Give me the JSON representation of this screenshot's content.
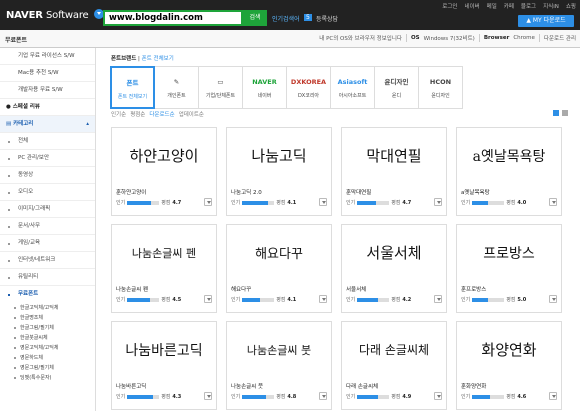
{
  "header": {
    "logo_brand": "NAVER",
    "logo_product": "Software",
    "search_value": "www.blogdalin.com",
    "search_button": "검색",
    "popular_link": "인기검색어",
    "badge": "5",
    "reg_link": "등록상담",
    "util_links": [
      "로그인",
      "네이버",
      "메일",
      "카페",
      "블로그",
      "지식iN",
      "쇼핑"
    ],
    "my_download": "MY 다운로드"
  },
  "subbar": {
    "title": "무료폰트",
    "os_notice": "내 PC의 OS와 브라우저 정보입니다",
    "os_label": "OS",
    "os_value": "Windows 7(32비트)",
    "browser_label": "Browser",
    "browser_value": "Chrome",
    "change": "다운로드 관리"
  },
  "sidebar": {
    "items": [
      {
        "label": "기업 무료 라이선스 S/W",
        "type": "item"
      },
      {
        "label": "Mac용 추천 S/W",
        "type": "item"
      },
      {
        "label": "개발자용 무료 S/W",
        "type": "item"
      },
      {
        "label": "스페셜 리뷰",
        "type": "hd"
      },
      {
        "label": "카테고리",
        "type": "hl"
      },
      {
        "label": "전체",
        "type": "item"
      },
      {
        "label": "PC 관리/보안",
        "type": "item"
      },
      {
        "label": "동영상",
        "type": "item"
      },
      {
        "label": "오디오",
        "type": "item"
      },
      {
        "label": "이미지/그래픽",
        "type": "item"
      },
      {
        "label": "문서/사무",
        "type": "item"
      },
      {
        "label": "게임/교육",
        "type": "item"
      },
      {
        "label": "인터넷/네트워크",
        "type": "item"
      },
      {
        "label": "유틸리티",
        "type": "item"
      },
      {
        "label": "무료폰트",
        "type": "item"
      }
    ],
    "subitems": [
      "한글고딕체/고딕체",
      "한글명조체",
      "한글그림/필기체",
      "한글붓글씨체",
      "영문고딕체/고딕체",
      "영문하드체",
      "영문그림/필기체",
      "딩벳(특수문자)"
    ]
  },
  "main": {
    "crumb_title": "폰트브랜드",
    "crumb_link": "폰트 전체보기",
    "categories": [
      {
        "icon": "폰트",
        "label": "폰트 전체보기",
        "active": true
      },
      {
        "icon": "✎",
        "label": "개인폰트"
      },
      {
        "icon": "▭",
        "label": "기업/단체폰트"
      },
      {
        "icon": "NAVER",
        "label": "네이버",
        "color": "#1ea43a"
      },
      {
        "icon": "DXKOREA",
        "label": "DX코리아",
        "color": "#c0392b"
      },
      {
        "icon": "Asiasoft",
        "label": "아시아소프트",
        "color": "#2d8fe6"
      },
      {
        "icon": "윤디자인",
        "label": "윤디"
      },
      {
        "icon": "HCON",
        "label": "윤디자인"
      }
    ],
    "sort": [
      "인기순",
      "평점순",
      "다운로드순",
      "업데이트순"
    ],
    "sort_active": 2,
    "rating_label": "인기",
    "score_label": "평점",
    "fonts": [
      {
        "preview": "하얀고양이",
        "name": "훈하얀고양이",
        "pop": 0.75,
        "score": "4.7",
        "size": 15
      },
      {
        "preview": "나눔고딕",
        "name": "나눔고딕 2.0",
        "pop": 0.8,
        "score": "4.1",
        "size": 15
      },
      {
        "preview": "막대연필",
        "name": "훈막대연필",
        "pop": 0.6,
        "score": "4.7",
        "size": 15
      },
      {
        "preview": "a옛날목욕탕",
        "name": "a옛날목욕탕",
        "pop": 0.5,
        "score": "4.0",
        "size": 14
      },
      {
        "preview": "나눔손글씨 펜",
        "name": "나눔손글씨 펜",
        "pop": 0.7,
        "score": "4.5",
        "size": 11
      },
      {
        "preview": "해요다꾸",
        "name": "해요다꾸",
        "pop": 0.55,
        "score": "4.1",
        "size": 13
      },
      {
        "preview": "서울서체",
        "name": "서울서체",
        "pop": 0.65,
        "score": "4.2",
        "size": 15
      },
      {
        "preview": "프로방스",
        "name": "훈프로방스",
        "pop": 0.5,
        "score": "5.0",
        "size": 14
      },
      {
        "preview": "나눔바른고딕",
        "name": "나눔바른고딕",
        "pop": 0.8,
        "score": "4.3",
        "size": 14
      },
      {
        "preview": "나눔손글씨 붓",
        "name": "나눔손글씨 붓",
        "pop": 0.75,
        "score": "4.8",
        "size": 11
      },
      {
        "preview": "다래 손글씨체",
        "name": "다래 손글씨체",
        "pop": 0.65,
        "score": "4.9",
        "size": 12
      },
      {
        "preview": "화양연화",
        "name": "훈화양연화",
        "pop": 0.55,
        "score": "4.6",
        "size": 15
      }
    ]
  },
  "colors": {
    "accent": "#2d8fe6",
    "naver_green": "#1ea43a",
    "topbar": "#222222"
  }
}
